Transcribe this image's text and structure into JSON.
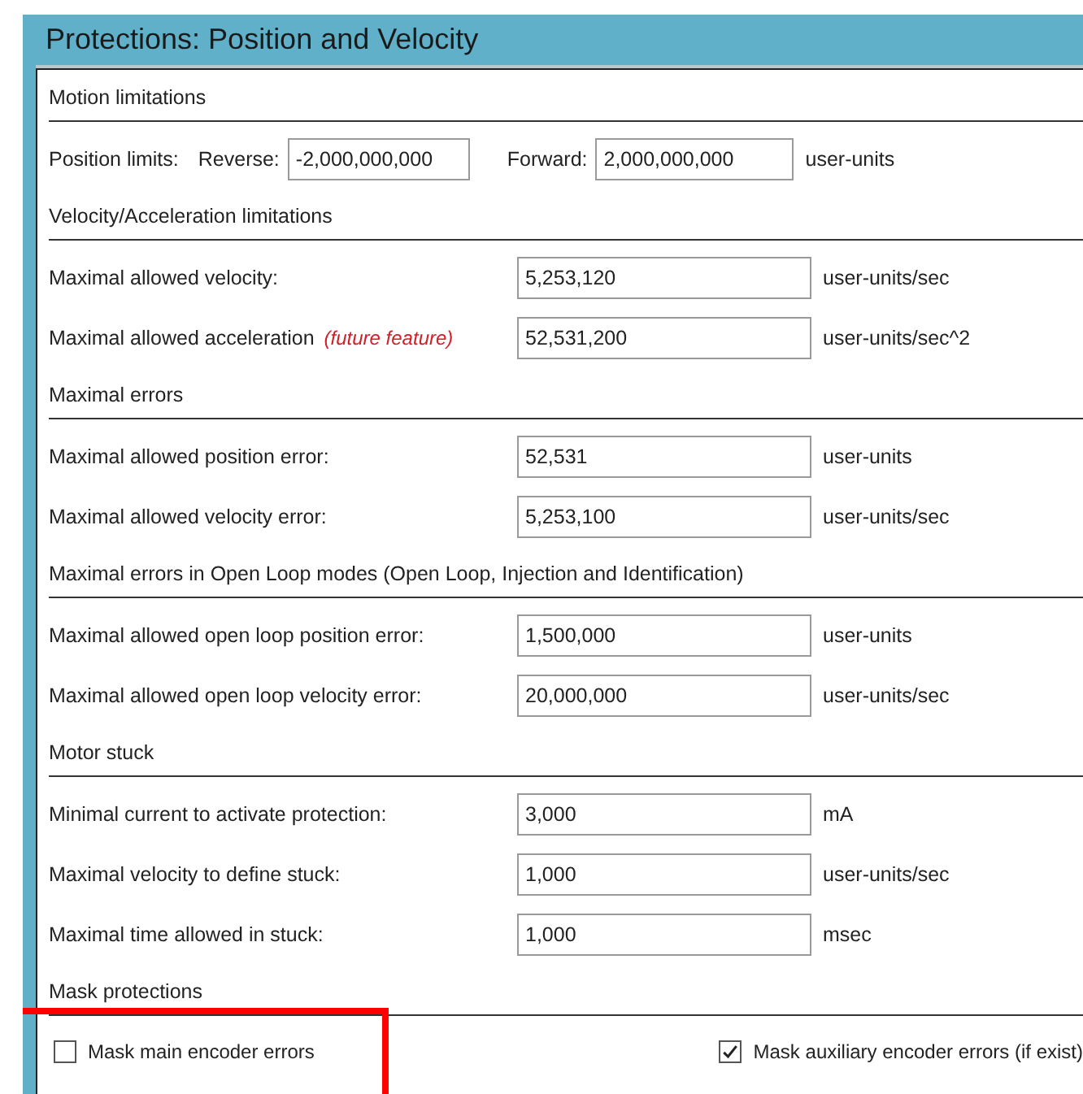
{
  "panel": {
    "title": "Protections: Position and Velocity"
  },
  "sections": [
    {
      "title": "Motion limitations",
      "rows": [
        {
          "kind": "limits",
          "label": "Position limits:",
          "reverse_label": "Reverse:",
          "reverse_value": "-2,000,000,000",
          "forward_label": "Forward:",
          "forward_value": "2,000,000,000",
          "unit": "user-units"
        }
      ]
    },
    {
      "title": "Velocity/Acceleration limitations",
      "rows": [
        {
          "kind": "field",
          "label": "Maximal allowed velocity:",
          "value": "5,253,120",
          "unit": "user-units/sec"
        },
        {
          "kind": "field",
          "label": "Maximal allowed acceleration",
          "note": "(future feature)",
          "value": "52,531,200",
          "unit": "user-units/sec^2"
        }
      ]
    },
    {
      "title": "Maximal errors",
      "rows": [
        {
          "kind": "field",
          "label": "Maximal allowed position error:",
          "value": "52,531",
          "unit": "user-units"
        },
        {
          "kind": "field",
          "label": "Maximal allowed velocity error:",
          "value": "5,253,100",
          "unit": "user-units/sec"
        }
      ]
    },
    {
      "title": "Maximal errors in Open Loop modes (Open Loop, Injection and Identification)",
      "rows": [
        {
          "kind": "field",
          "label": "Maximal allowed open loop position error:",
          "value": "1,500,000",
          "unit": "user-units"
        },
        {
          "kind": "field",
          "label": "Maximal allowed open loop velocity error:",
          "value": "20,000,000",
          "unit": "user-units/sec"
        }
      ]
    },
    {
      "title": "Motor stuck",
      "rows": [
        {
          "kind": "field",
          "label": "Minimal current to activate protection:",
          "value": "3,000",
          "unit": "mA"
        },
        {
          "kind": "field",
          "label": "Maximal velocity to define stuck:",
          "value": "1,000",
          "unit": "user-units/sec"
        },
        {
          "kind": "field",
          "label": "Maximal time allowed in stuck:",
          "value": "1,000",
          "unit": "msec"
        }
      ]
    },
    {
      "title": "Mask protections",
      "rows": [
        {
          "kind": "checks",
          "items": [
            {
              "label": "Mask main encoder errors",
              "checked": false,
              "highlighted": true
            },
            {
              "label": "Mask auxiliary encoder errors (if exist)",
              "checked": true,
              "highlighted": false
            }
          ]
        }
      ]
    }
  ]
}
